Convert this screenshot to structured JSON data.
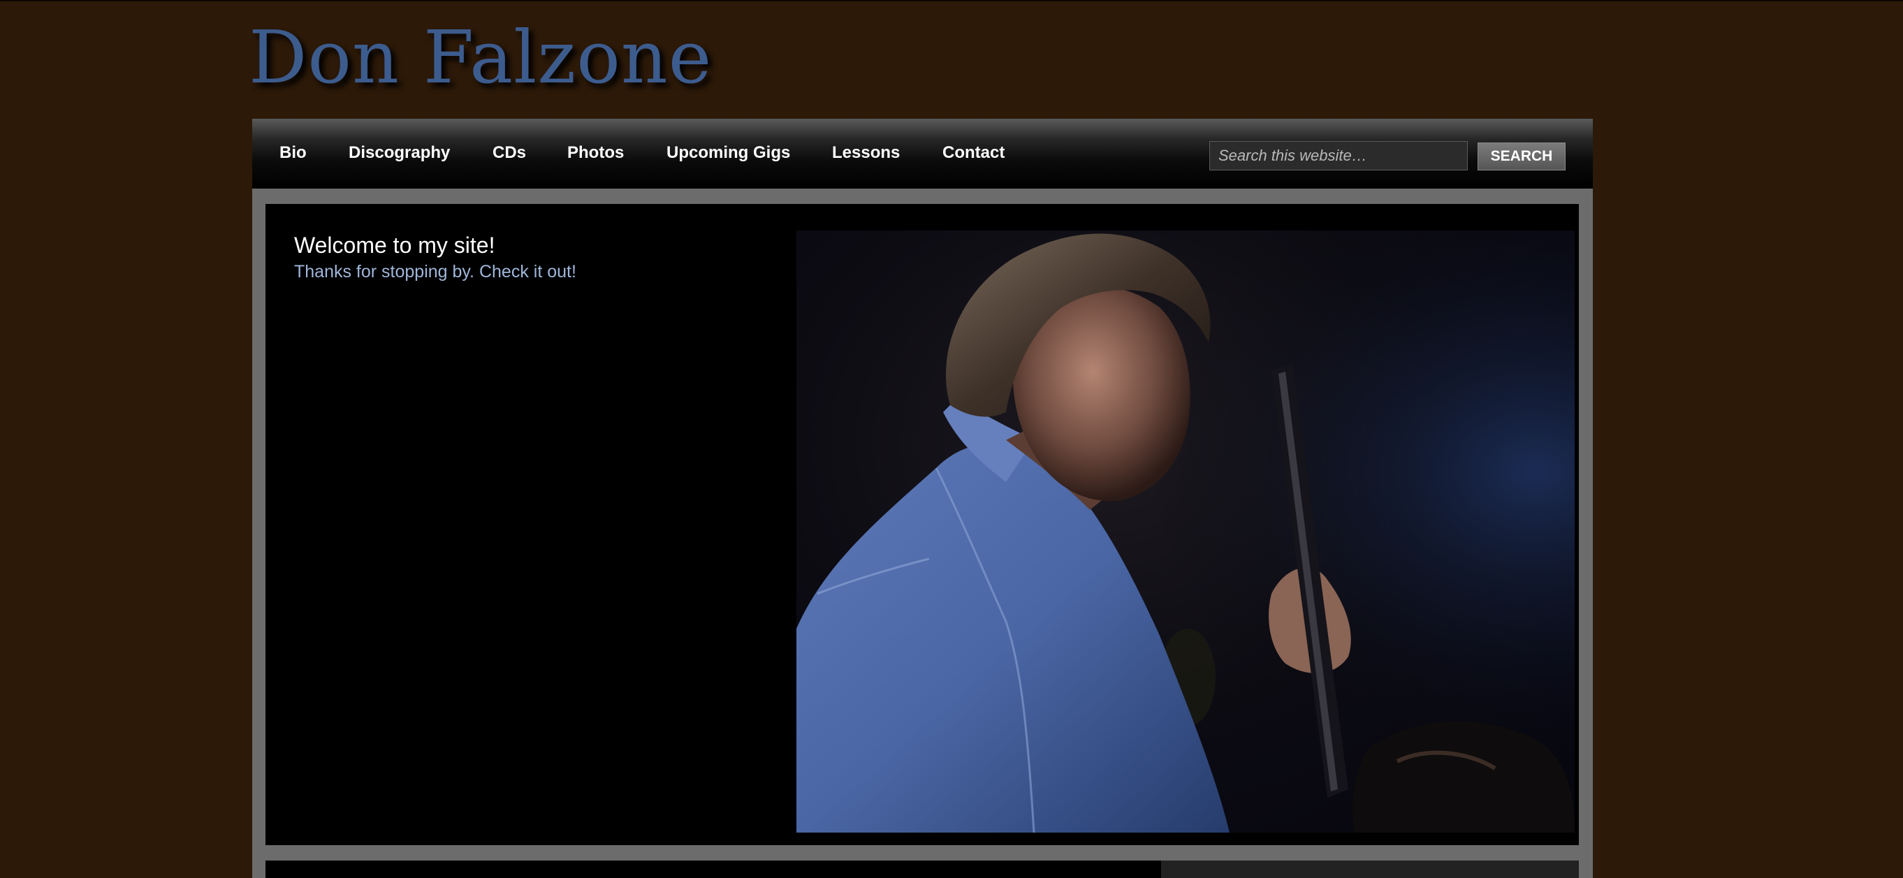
{
  "site": {
    "title": "Don Falzone"
  },
  "nav": {
    "items": [
      {
        "label": "Bio"
      },
      {
        "label": "Discography"
      },
      {
        "label": "CDs"
      },
      {
        "label": "Photos"
      },
      {
        "label": "Upcoming Gigs"
      },
      {
        "label": "Lessons"
      },
      {
        "label": "Contact"
      }
    ]
  },
  "search": {
    "placeholder": "Search this website…",
    "button_label": "SEARCH"
  },
  "feature": {
    "heading": "Welcome to my site!",
    "subheading": "Thanks for stopping by. Check it out!"
  },
  "colors": {
    "page_background": "#2c1908",
    "title_color": "#3d5c8e",
    "subheading_color": "#9fb6d9",
    "frame_gray": "#6c6c6c"
  }
}
